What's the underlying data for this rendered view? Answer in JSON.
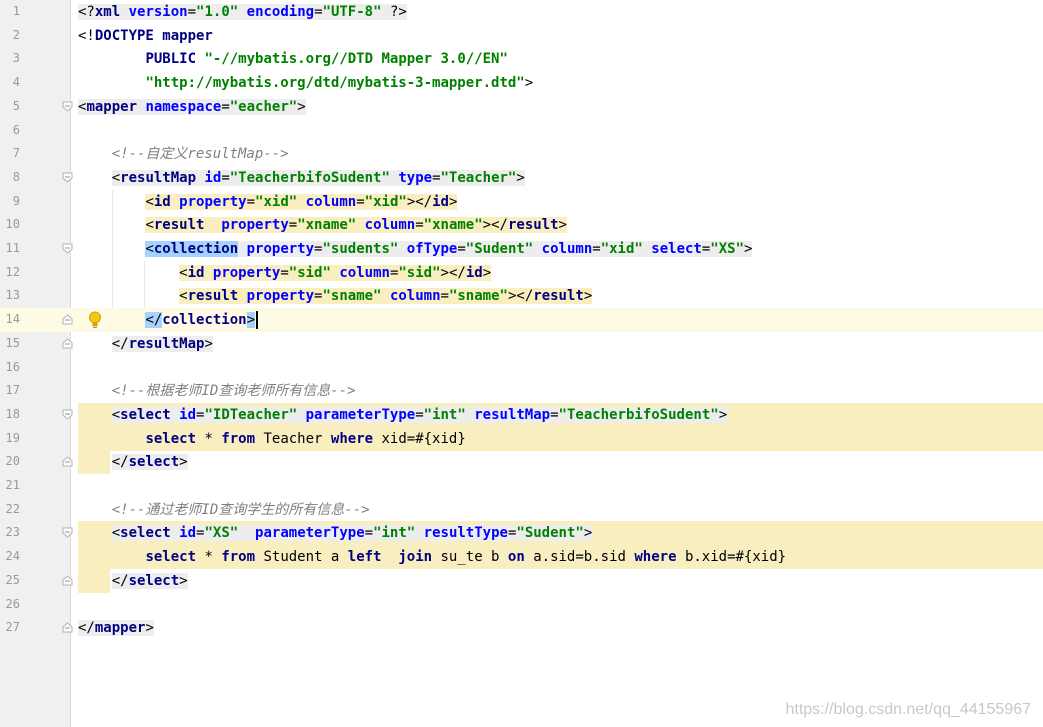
{
  "lines": [
    {
      "n": "1",
      "segs": [
        [
          "ab",
          "<?"
        ],
        [
          "kw",
          "xml"
        ],
        [
          "tx",
          " "
        ],
        [
          "at",
          "version"
        ],
        [
          "ab",
          "="
        ],
        [
          "st",
          "\"1.0\""
        ],
        [
          "tx",
          " "
        ],
        [
          "at",
          "encoding"
        ],
        [
          "ab",
          "="
        ],
        [
          "st",
          "\"UTF-8\""
        ],
        [
          "tx",
          " "
        ],
        [
          "ab",
          "?>"
        ]
      ]
    },
    {
      "n": "2",
      "segs": [
        [
          "ab",
          "<!"
        ],
        [
          "kw",
          "DOCTYPE mapper"
        ]
      ]
    },
    {
      "n": "3",
      "segs": [
        [
          "tx",
          "        "
        ],
        [
          "kw",
          "PUBLIC "
        ],
        [
          "st",
          "\"-//mybatis.org//DTD Mapper 3.0//EN\""
        ]
      ]
    },
    {
      "n": "4",
      "segs": [
        [
          "tx",
          "        "
        ],
        [
          "st",
          "\"http://mybatis.org/dtd/mybatis-3-mapper.dtd\""
        ],
        [
          "ab",
          ">"
        ]
      ]
    },
    {
      "n": "5",
      "segs": [
        [
          "ab",
          "<"
        ],
        [
          "kw",
          "mapper "
        ],
        [
          "at",
          "namespace"
        ],
        [
          "ab",
          "="
        ],
        [
          "st",
          "\"eacher\""
        ],
        [
          "ab",
          ">"
        ]
      ]
    },
    {
      "n": "6",
      "segs": []
    },
    {
      "n": "7",
      "segs": [
        [
          "tx",
          "    "
        ],
        [
          "cm",
          "<!--自定义resultMap-->"
        ]
      ]
    },
    {
      "n": "8",
      "segs": [
        [
          "tx",
          "    "
        ],
        [
          "ab",
          "<"
        ],
        [
          "kw",
          "resultMap "
        ],
        [
          "at",
          "id"
        ],
        [
          "ab",
          "="
        ],
        [
          "st",
          "\"TeacherbifoSudent\""
        ],
        [
          "tx",
          " "
        ],
        [
          "at",
          "type"
        ],
        [
          "ab",
          "="
        ],
        [
          "st",
          "\"Teacher\""
        ],
        [
          "ab",
          ">"
        ]
      ]
    },
    {
      "n": "9",
      "segs": [
        [
          "tx",
          "        "
        ],
        [
          "ab",
          "<"
        ],
        [
          "kw",
          "id "
        ],
        [
          "at",
          "property"
        ],
        [
          "ab",
          "="
        ],
        [
          "st",
          "\"xid\""
        ],
        [
          "tx",
          " "
        ],
        [
          "at",
          "column"
        ],
        [
          "ab",
          "="
        ],
        [
          "st",
          "\"xid\""
        ],
        [
          "ab",
          "></"
        ],
        [
          "kw",
          "id"
        ],
        [
          "ab",
          ">"
        ]
      ]
    },
    {
      "n": "10",
      "segs": [
        [
          "tx",
          "        "
        ],
        [
          "ab",
          "<"
        ],
        [
          "kw",
          "result  "
        ],
        [
          "at",
          "property"
        ],
        [
          "ab",
          "="
        ],
        [
          "st",
          "\"xname\""
        ],
        [
          "tx",
          " "
        ],
        [
          "at",
          "column"
        ],
        [
          "ab",
          "="
        ],
        [
          "st",
          "\"xname\""
        ],
        [
          "ab",
          "></"
        ],
        [
          "kw",
          "result"
        ],
        [
          "ab",
          ">"
        ]
      ]
    },
    {
      "n": "11",
      "segs": [
        [
          "tx",
          "        "
        ],
        [
          "ab",
          "<"
        ],
        [
          "kw",
          "collection"
        ],
        [
          "tx",
          " "
        ],
        [
          "at",
          "property"
        ],
        [
          "ab",
          "="
        ],
        [
          "st",
          "\"sudents\""
        ],
        [
          "tx",
          " "
        ],
        [
          "at",
          "ofType"
        ],
        [
          "ab",
          "="
        ],
        [
          "st",
          "\"Sudent\""
        ],
        [
          "tx",
          " "
        ],
        [
          "at",
          "column"
        ],
        [
          "ab",
          "="
        ],
        [
          "st",
          "\"xid\""
        ],
        [
          "tx",
          " "
        ],
        [
          "at",
          "select"
        ],
        [
          "ab",
          "="
        ],
        [
          "st",
          "\"XS\""
        ],
        [
          "ab",
          ">"
        ]
      ]
    },
    {
      "n": "12",
      "segs": [
        [
          "tx",
          "            "
        ],
        [
          "ab",
          "<"
        ],
        [
          "kw",
          "id "
        ],
        [
          "at",
          "property"
        ],
        [
          "ab",
          "="
        ],
        [
          "st",
          "\"sid\""
        ],
        [
          "tx",
          " "
        ],
        [
          "at",
          "column"
        ],
        [
          "ab",
          "="
        ],
        [
          "st",
          "\"sid\""
        ],
        [
          "ab",
          "></"
        ],
        [
          "kw",
          "id"
        ],
        [
          "ab",
          ">"
        ]
      ]
    },
    {
      "n": "13",
      "segs": [
        [
          "tx",
          "            "
        ],
        [
          "ab",
          "<"
        ],
        [
          "kw",
          "result "
        ],
        [
          "at",
          "property"
        ],
        [
          "ab",
          "="
        ],
        [
          "st",
          "\"sname\""
        ],
        [
          "tx",
          " "
        ],
        [
          "at",
          "column"
        ],
        [
          "ab",
          "="
        ],
        [
          "st",
          "\"sname\""
        ],
        [
          "ab",
          "></"
        ],
        [
          "kw",
          "result"
        ],
        [
          "ab",
          ">"
        ]
      ]
    },
    {
      "n": "14",
      "segs": [
        [
          "tx",
          "        "
        ],
        [
          "ab",
          "</"
        ],
        [
          "kw",
          "collection"
        ],
        [
          "ab",
          ">"
        ]
      ]
    },
    {
      "n": "15",
      "segs": [
        [
          "tx",
          "    "
        ],
        [
          "ab",
          "</"
        ],
        [
          "kw",
          "resultMap"
        ],
        [
          "ab",
          ">"
        ]
      ]
    },
    {
      "n": "16",
      "segs": []
    },
    {
      "n": "17",
      "segs": [
        [
          "tx",
          "    "
        ],
        [
          "cm",
          "<!--根据老师ID查询老师所有信息-->"
        ]
      ]
    },
    {
      "n": "18",
      "segs": [
        [
          "tx",
          "    "
        ],
        [
          "ab",
          "<"
        ],
        [
          "kw",
          "select "
        ],
        [
          "at",
          "id"
        ],
        [
          "ab",
          "="
        ],
        [
          "st",
          "\"IDTeacher\""
        ],
        [
          "tx",
          " "
        ],
        [
          "at",
          "parameterType"
        ],
        [
          "ab",
          "="
        ],
        [
          "st",
          "\"int\""
        ],
        [
          "tx",
          " "
        ],
        [
          "at",
          "resultMap"
        ],
        [
          "ab",
          "="
        ],
        [
          "st",
          "\"TeacherbifoSudent\""
        ],
        [
          "ab",
          ">"
        ]
      ]
    },
    {
      "n": "19",
      "segs": [
        [
          "tx",
          "        "
        ],
        [
          "kw",
          "select "
        ],
        [
          "tx",
          "* "
        ],
        [
          "kw",
          "from "
        ],
        [
          "tx",
          "Teacher "
        ],
        [
          "kw",
          "where "
        ],
        [
          "tx",
          "xid=#{xid}"
        ]
      ]
    },
    {
      "n": "20",
      "segs": [
        [
          "tx",
          "    "
        ],
        [
          "ab",
          "</"
        ],
        [
          "kw",
          "select"
        ],
        [
          "ab",
          ">"
        ]
      ]
    },
    {
      "n": "21",
      "segs": []
    },
    {
      "n": "22",
      "segs": [
        [
          "tx",
          "    "
        ],
        [
          "cm",
          "<!--通过老师ID查询学生的所有信息-->"
        ]
      ]
    },
    {
      "n": "23",
      "segs": [
        [
          "tx",
          "    "
        ],
        [
          "ab",
          "<"
        ],
        [
          "kw",
          "select "
        ],
        [
          "at",
          "id"
        ],
        [
          "ab",
          "="
        ],
        [
          "st",
          "\"XS\""
        ],
        [
          "tx",
          "  "
        ],
        [
          "at",
          "parameterType"
        ],
        [
          "ab",
          "="
        ],
        [
          "st",
          "\"int\""
        ],
        [
          "tx",
          " "
        ],
        [
          "at",
          "resultType"
        ],
        [
          "ab",
          "="
        ],
        [
          "st",
          "\"Sudent\""
        ],
        [
          "ab",
          ">"
        ]
      ]
    },
    {
      "n": "24",
      "segs": [
        [
          "tx",
          "        "
        ],
        [
          "kw",
          "select "
        ],
        [
          "tx",
          "* "
        ],
        [
          "kw",
          "from "
        ],
        [
          "tx",
          "Student a "
        ],
        [
          "kw",
          "left  join "
        ],
        [
          "tx",
          "su_te b "
        ],
        [
          "kw",
          "on "
        ],
        [
          "tx",
          "a.sid=b.sid "
        ],
        [
          "kw",
          "where "
        ],
        [
          "tx",
          "b.xid=#{xid}"
        ]
      ]
    },
    {
      "n": "25",
      "segs": [
        [
          "tx",
          "    "
        ],
        [
          "ab",
          "</"
        ],
        [
          "kw",
          "select"
        ],
        [
          "ab",
          ">"
        ]
      ]
    },
    {
      "n": "26",
      "segs": []
    },
    {
      "n": "27",
      "segs": [
        [
          "ab",
          "</"
        ],
        [
          "kw",
          "mapper"
        ],
        [
          "ab",
          ">"
        ]
      ]
    }
  ],
  "watermark": "https://blog.csdn.net/qq_44155967",
  "colors": {
    "tag": "#000080",
    "attr": "#0000ff",
    "string": "#008000",
    "comment": "#808080",
    "highlight": "#f8eec0",
    "selection": "#a6d2ff",
    "currentLine": "#fffae3"
  },
  "icons": {
    "fold": "fold-marker-icon",
    "bulb": "intention-bulb-icon"
  }
}
